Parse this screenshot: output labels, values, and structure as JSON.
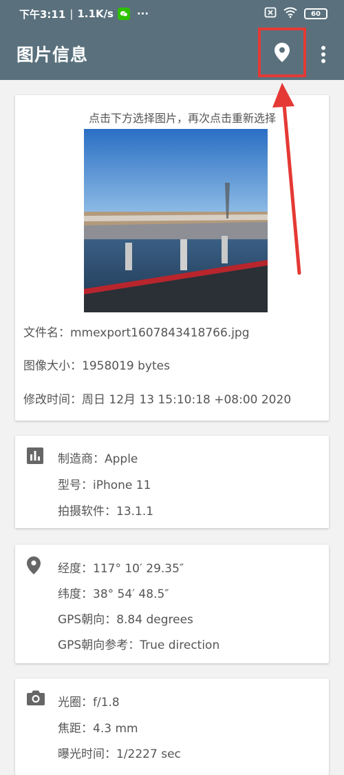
{
  "status_bar": {
    "time": "下午3:11",
    "speed": "1.1K/s",
    "dots": "···",
    "battery": "60"
  },
  "toolbar": {
    "title": "图片信息"
  },
  "image_card": {
    "hint": "点击下方选择图片，再次点击重新选择",
    "file_name": "文件名：mmexport1607843418766.jpg",
    "image_size": "图像大小：1958019 bytes",
    "modified_time": "修改时间：周日 12月 13 15:10:18 +08:00 2020"
  },
  "device_card": {
    "icon": "bar-chart-icon",
    "rows": [
      "制造商：Apple",
      "型号：iPhone 11",
      "拍摄软件：13.1.1"
    ]
  },
  "gps_card": {
    "icon": "location-pin-icon",
    "rows": [
      "经度：117° 10′ 29.35″",
      "纬度：38° 54′ 48.5″",
      "GPS朝向：8.84 degrees",
      "GPS朝向参考：True direction"
    ]
  },
  "camera_card": {
    "icon": "camera-icon",
    "rows": [
      "光圈：f/1.8",
      "焦距：4.3 mm",
      "曝光时间：1/2227 sec"
    ]
  },
  "colors": {
    "toolbar": "#5a717d",
    "highlight": "#e53935",
    "background": "#f2f2f2"
  }
}
